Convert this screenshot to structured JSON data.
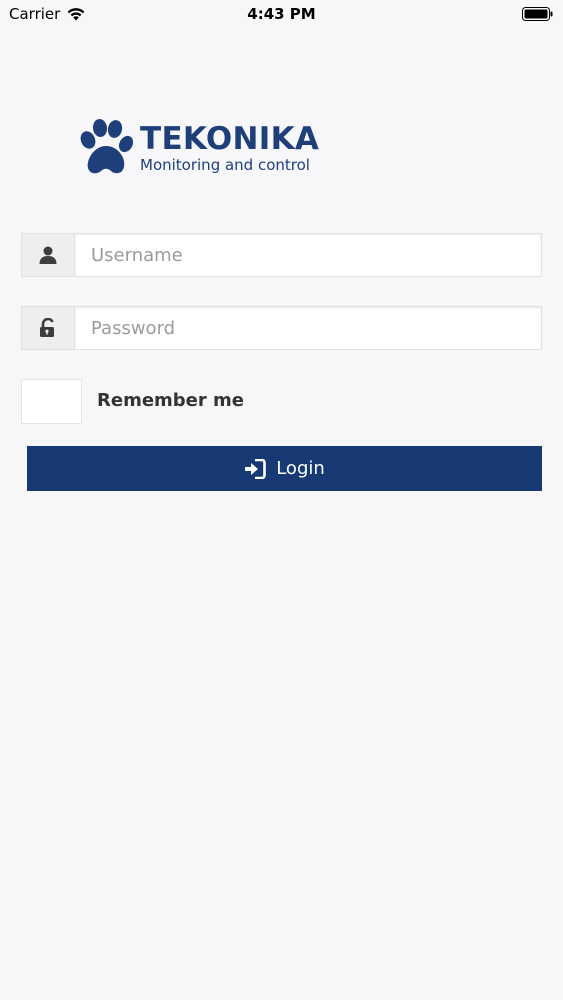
{
  "status_bar": {
    "carrier": "Carrier",
    "time": "4:43 PM",
    "wifi_icon": "wifi-icon",
    "battery_icon": "battery-icon"
  },
  "logo": {
    "title": "TEKONIKA",
    "subtitle": "Monitoring and control",
    "icon": "paw-icon",
    "color": "#1e3f79"
  },
  "form": {
    "username": {
      "placeholder": "Username",
      "value": "",
      "icon": "user-icon"
    },
    "password": {
      "placeholder": "Password",
      "value": "",
      "icon": "lock-icon"
    },
    "remember_me": {
      "label": "Remember me",
      "checked": false
    },
    "login_button": {
      "label": "Login",
      "icon": "sign-in-icon",
      "color": "#183a74"
    }
  }
}
